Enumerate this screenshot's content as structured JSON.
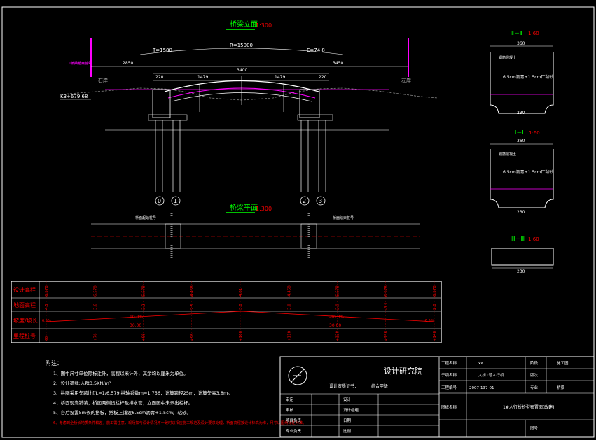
{
  "elevation": {
    "title": "桥梁立面",
    "scale": "1:300",
    "T": "T=1500",
    "R": "R=15000",
    "E": "E=74.8",
    "dim_left": "2850",
    "dim_right": "3450",
    "dim_center": "3400",
    "dim_220_l": "220",
    "dim_220_r": "220",
    "dim_1479_l": "1479",
    "dim_1479_r": "1479",
    "left_bank": "右岸",
    "right_bank": "左岸",
    "station": "K3+679.68",
    "left_tag": "桥梁起点桩号"
  },
  "plan": {
    "title": "桥梁平面",
    "scale": "1:300",
    "left_note": "桥面起始桩号",
    "right_note": "桥面结束桩号"
  },
  "piers": [
    "0",
    "1",
    "2",
    "3"
  ],
  "sections": [
    {
      "title": "Ⅱ－Ⅱ",
      "scale": "1:60",
      "top": "360",
      "bottom": "230",
      "label1": "钢筋混凝土",
      "label2": "6.5cm沥青+1.5cm厂粘砂"
    },
    {
      "title": "Ⅰ－Ⅰ",
      "scale": "1:60",
      "top": "360",
      "bottom": "230",
      "label1": "钢筋混凝土",
      "label2": "6.5cm沥青+1.5cm厂粘砂"
    },
    {
      "title": "Ⅲ－Ⅲ",
      "scale": "1:60",
      "bottom": "230"
    }
  ],
  "profile_table": {
    "rows": [
      "设计高程",
      "地面高程",
      "坡度/坡长",
      "里程桩号"
    ],
    "design_elev": [
      "6.578",
      "6.578",
      "5.578",
      "4.468",
      "4.81",
      "4.468",
      "5.578",
      "6.578",
      "6.578"
    ],
    "ground_elev": [
      "4.5",
      "3.6",
      "3.2",
      "2.5",
      "3.0",
      "3.0",
      "2.0",
      "-0.1",
      "2.0"
    ],
    "slope_left": "10.0%",
    "slope_left_len": "30.00",
    "slope_right": "-10.0%",
    "slope_right_len": "30.00",
    "slope_left_end": "6.5%",
    "slope_right_end": "-6.5%",
    "stations": [
      "K0",
      "+76",
      "+88",
      "+98",
      "+108",
      "+118",
      "+128",
      "+138",
      "+148"
    ]
  },
  "notes": {
    "heading": "附注：",
    "items": [
      "1、图中尺寸单位除标注外，高程以米计外，其余均以厘米为单位。",
      "2、设计荷载:人群3.5KN/m²",
      "3、拱圈采用矢跨比f/L=1/6.579,拱轴系数m=1.756，计算跨径25m，计算矢高3.8m。",
      "4、桥面现浇铺装，桥面两侧设栏杆及排水管，立面图中未示出栏杆。",
      "5、台后设置5m长的搭板，搭板上铺设6.5cm沥青+1.5cm厂粘砂。",
      "6、考虑到全桥长地质条件较差，施工需注意，现场如与设计情况不一致时以相应施工规范及设计要求处理，桥面高程按设计标高为准，尺寸以图纸标注为准。"
    ]
  },
  "title_block": {
    "company": "设计研究院",
    "cert": "设计资质证书：",
    "cert_val": "综合甲级",
    "project_label": "工程名称",
    "project_val": "xx",
    "subproject_label": "子项名称",
    "subproject_val": "大桥1号人行桥",
    "number_label": "工程编号",
    "number_val": "2007-137-01",
    "stage_label": "阶段",
    "stage_val": "施工图",
    "version_label": "版次",
    "major_label": "专业",
    "major_val": "桥梁",
    "drawing_name_label": "图纸名称",
    "drawing_name_val": "1#人行桥桥型布置图(改建)",
    "drawing_no_label": "图号",
    "sign_rows": [
      {
        "a": "审定",
        "b": "",
        "c": "设计",
        "d": ""
      },
      {
        "a": "审核",
        "b": "",
        "c": "设计组组",
        "d": ""
      },
      {
        "a": "项目负责",
        "b": "",
        "c": "日期",
        "d": ""
      },
      {
        "a": "专业负责",
        "b": "",
        "c": "比例",
        "d": ""
      }
    ]
  },
  "colors": {
    "line": "#ffffff",
    "green": "#00ff00",
    "cyan": "#00ffff",
    "magenta": "#ff00ff",
    "red": "#ff0000",
    "yellow": "#ffff00"
  }
}
